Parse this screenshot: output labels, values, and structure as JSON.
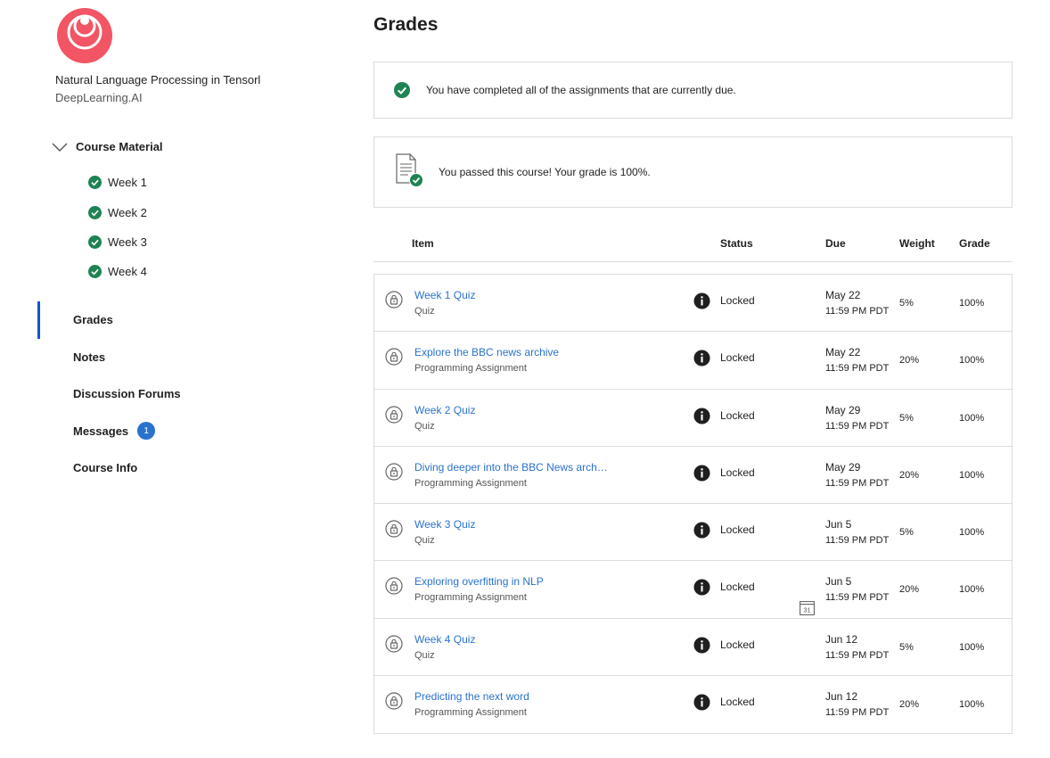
{
  "sidebar": {
    "course_title": "Natural Language Processing in Tensorl",
    "course_org": "DeepLearning.AI",
    "material_label": "Course Material",
    "weeks": [
      {
        "label": "Week 1"
      },
      {
        "label": "Week 2"
      },
      {
        "label": "Week 3"
      },
      {
        "label": "Week 4"
      }
    ],
    "nav": {
      "grades": "Grades",
      "notes": "Notes",
      "forums": "Discussion Forums",
      "messages": "Messages",
      "messages_count": "1",
      "course_info": "Course Info"
    }
  },
  "main": {
    "title": "Grades",
    "completed_msg": "You have completed all of the assignments that are currently due.",
    "passed_msg": "You passed this course! Your grade is 100%.",
    "headers": {
      "item": "Item",
      "status": "Status",
      "due": "Due",
      "weight": "Weight",
      "grade": "Grade"
    },
    "rows": [
      {
        "title": "Week 1 Quiz",
        "type": "Quiz",
        "status": "Locked",
        "due_date": "May 22",
        "due_time": "11:59 PM PDT",
        "weight": "5%",
        "grade": "100%"
      },
      {
        "title": "Explore the BBC news archive",
        "type": "Programming Assignment",
        "status": "Locked",
        "due_date": "May 22",
        "due_time": "11:59 PM PDT",
        "weight": "20%",
        "grade": "100%"
      },
      {
        "title": "Week 2 Quiz",
        "type": "Quiz",
        "status": "Locked",
        "due_date": "May 29",
        "due_time": "11:59 PM PDT",
        "weight": "5%",
        "grade": "100%"
      },
      {
        "title": "Diving deeper into the BBC News arch…",
        "type": "Programming Assignment",
        "status": "Locked",
        "due_date": "May 29",
        "due_time": "11:59 PM PDT",
        "weight": "20%",
        "grade": "100%"
      },
      {
        "title": "Week 3 Quiz",
        "type": "Quiz",
        "status": "Locked",
        "due_date": "Jun 5",
        "due_time": "11:59 PM PDT",
        "weight": "5%",
        "grade": "100%"
      },
      {
        "title": "Exploring overfitting in NLP",
        "type": "Programming Assignment",
        "status": "Locked",
        "due_date": "Jun 5",
        "due_time": "11:59 PM PDT",
        "weight": "20%",
        "grade": "100%",
        "calendar_day": "31"
      },
      {
        "title": "Week 4 Quiz",
        "type": "Quiz",
        "status": "Locked",
        "due_date": "Jun 12",
        "due_time": "11:59 PM PDT",
        "weight": "5%",
        "grade": "100%"
      },
      {
        "title": "Predicting the next word",
        "type": "Programming Assignment",
        "status": "Locked",
        "due_date": "Jun 12",
        "due_time": "11:59 PM PDT",
        "weight": "20%",
        "grade": "100%"
      }
    ]
  },
  "colors": {
    "brand_logo": "#f25563",
    "check_green": "#1f8354",
    "link_blue": "#2a73cc",
    "active_nav": "#0056d2"
  }
}
